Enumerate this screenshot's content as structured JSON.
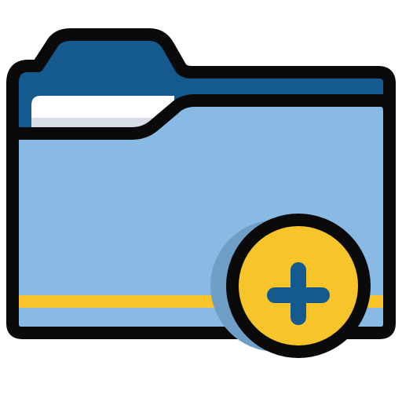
{
  "icon": {
    "name": "add-folder-icon",
    "parts": [
      "folder-back",
      "folder-paper",
      "folder-front",
      "folder-stripe",
      "add-badge",
      "plus-sign"
    ]
  },
  "colors": {
    "outline": "#0a0a0a",
    "folder_back": "#155a8f",
    "folder_front": "#88bae3",
    "folder_shadow": "#6f9fc7",
    "paper": "#ffffff",
    "paper_shadow": "#d7dde6",
    "stripe": "#f7c52a",
    "badge": "#f7c52a",
    "plus": "#155a8f"
  }
}
